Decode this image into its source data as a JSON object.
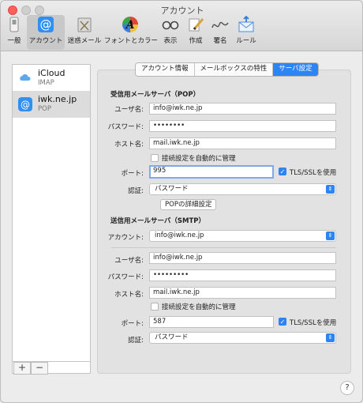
{
  "window": {
    "title": "アカウント"
  },
  "toolbar": [
    {
      "label": "一般",
      "icon": "switch-icon"
    },
    {
      "label": "アカウント",
      "icon": "at-icon"
    },
    {
      "label": "迷惑メール",
      "icon": "junk-mail-icon"
    },
    {
      "label": "フォントとカラー",
      "icon": "font-color-icon"
    },
    {
      "label": "表示",
      "icon": "glasses-icon"
    },
    {
      "label": "作成",
      "icon": "pencil-icon"
    },
    {
      "label": "署名",
      "icon": "signature-icon"
    },
    {
      "label": "ルール",
      "icon": "rules-icon"
    }
  ],
  "accounts": [
    {
      "name": "iCloud",
      "type": "IMAP",
      "icon": "cloud-icon"
    },
    {
      "name": "iwk.ne.jp",
      "type": "POP",
      "icon": "at-icon"
    }
  ],
  "sidebar_buttons": {
    "add": "+",
    "remove": "−"
  },
  "tabs": [
    "アカウント情報",
    "メールボックスの特性",
    "サーバ設定"
  ],
  "incoming": {
    "title": "受信用メールサーバ（POP）",
    "username_label": "ユーザ名:",
    "username": "info@iwk.ne.jp",
    "password_label": "パスワード:",
    "password": "••••••••",
    "host_label": "ホスト名:",
    "host": "mail.iwk.ne.jp",
    "auto_manage_label": "接続設定を自動的に管理",
    "port_label": "ポート:",
    "port": "995",
    "tls_label": "TLS/SSLを使用",
    "auth_label": "認証:",
    "auth": "パスワード",
    "pop_detail_button": "POPの詳細設定"
  },
  "outgoing": {
    "title": "送信用メールサーバ（SMTP）",
    "account_label": "アカウント:",
    "account": "info@iwk.ne.jp",
    "username_label": "ユーザ名:",
    "username": "info@iwk.ne.jp",
    "password_label": "パスワード:",
    "password": "•••••••••",
    "host_label": "ホスト名:",
    "host": "mail.iwk.ne.jp",
    "auto_manage_label": "接続設定を自動的に管理",
    "port_label": "ポート:",
    "port": "587",
    "tls_label": "TLS/SSLを使用",
    "auth_label": "認証:",
    "auth": "パスワード"
  },
  "help": "?",
  "colors": {
    "accent": "#2c84f5",
    "close": "#fc605c"
  }
}
